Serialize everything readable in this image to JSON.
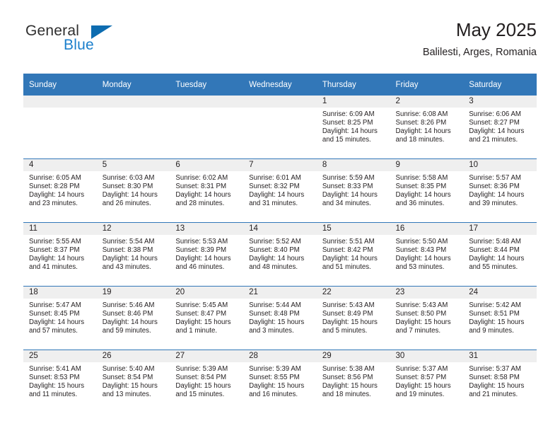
{
  "brand": {
    "name_part1": "General",
    "name_part2": "Blue",
    "icon": "triangle-logo-icon",
    "colors": {
      "blue": "#1b7fcc",
      "triangle": "#0d6cb0",
      "dark": "#2f2f2f"
    }
  },
  "header": {
    "title": "May 2025",
    "subtitle": "Balilesti, Arges, Romania"
  },
  "theme": {
    "header_row_bg": "#3277b8",
    "header_row_text": "#ffffff",
    "daynum_band_bg": "#efefef",
    "row_divider": "#3277b8",
    "cell_bg": "#ffffff",
    "text": "#231f20"
  },
  "weekdays": [
    "Sunday",
    "Monday",
    "Tuesday",
    "Wednesday",
    "Thursday",
    "Friday",
    "Saturday"
  ],
  "weeks": [
    [
      {
        "day": "",
        "lines": []
      },
      {
        "day": "",
        "lines": []
      },
      {
        "day": "",
        "lines": []
      },
      {
        "day": "",
        "lines": []
      },
      {
        "day": "1",
        "lines": [
          "Sunrise: 6:09 AM",
          "Sunset: 8:25 PM",
          "Daylight: 14 hours and 15 minutes."
        ]
      },
      {
        "day": "2",
        "lines": [
          "Sunrise: 6:08 AM",
          "Sunset: 8:26 PM",
          "Daylight: 14 hours and 18 minutes."
        ]
      },
      {
        "day": "3",
        "lines": [
          "Sunrise: 6:06 AM",
          "Sunset: 8:27 PM",
          "Daylight: 14 hours and 21 minutes."
        ]
      }
    ],
    [
      {
        "day": "4",
        "lines": [
          "Sunrise: 6:05 AM",
          "Sunset: 8:28 PM",
          "Daylight: 14 hours and 23 minutes."
        ]
      },
      {
        "day": "5",
        "lines": [
          "Sunrise: 6:03 AM",
          "Sunset: 8:30 PM",
          "Daylight: 14 hours and 26 minutes."
        ]
      },
      {
        "day": "6",
        "lines": [
          "Sunrise: 6:02 AM",
          "Sunset: 8:31 PM",
          "Daylight: 14 hours and 28 minutes."
        ]
      },
      {
        "day": "7",
        "lines": [
          "Sunrise: 6:01 AM",
          "Sunset: 8:32 PM",
          "Daylight: 14 hours and 31 minutes."
        ]
      },
      {
        "day": "8",
        "lines": [
          "Sunrise: 5:59 AM",
          "Sunset: 8:33 PM",
          "Daylight: 14 hours and 34 minutes."
        ]
      },
      {
        "day": "9",
        "lines": [
          "Sunrise: 5:58 AM",
          "Sunset: 8:35 PM",
          "Daylight: 14 hours and 36 minutes."
        ]
      },
      {
        "day": "10",
        "lines": [
          "Sunrise: 5:57 AM",
          "Sunset: 8:36 PM",
          "Daylight: 14 hours and 39 minutes."
        ]
      }
    ],
    [
      {
        "day": "11",
        "lines": [
          "Sunrise: 5:55 AM",
          "Sunset: 8:37 PM",
          "Daylight: 14 hours and 41 minutes."
        ]
      },
      {
        "day": "12",
        "lines": [
          "Sunrise: 5:54 AM",
          "Sunset: 8:38 PM",
          "Daylight: 14 hours and 43 minutes."
        ]
      },
      {
        "day": "13",
        "lines": [
          "Sunrise: 5:53 AM",
          "Sunset: 8:39 PM",
          "Daylight: 14 hours and 46 minutes."
        ]
      },
      {
        "day": "14",
        "lines": [
          "Sunrise: 5:52 AM",
          "Sunset: 8:40 PM",
          "Daylight: 14 hours and 48 minutes."
        ]
      },
      {
        "day": "15",
        "lines": [
          "Sunrise: 5:51 AM",
          "Sunset: 8:42 PM",
          "Daylight: 14 hours and 51 minutes."
        ]
      },
      {
        "day": "16",
        "lines": [
          "Sunrise: 5:50 AM",
          "Sunset: 8:43 PM",
          "Daylight: 14 hours and 53 minutes."
        ]
      },
      {
        "day": "17",
        "lines": [
          "Sunrise: 5:48 AM",
          "Sunset: 8:44 PM",
          "Daylight: 14 hours and 55 minutes."
        ]
      }
    ],
    [
      {
        "day": "18",
        "lines": [
          "Sunrise: 5:47 AM",
          "Sunset: 8:45 PM",
          "Daylight: 14 hours and 57 minutes."
        ]
      },
      {
        "day": "19",
        "lines": [
          "Sunrise: 5:46 AM",
          "Sunset: 8:46 PM",
          "Daylight: 14 hours and 59 minutes."
        ]
      },
      {
        "day": "20",
        "lines": [
          "Sunrise: 5:45 AM",
          "Sunset: 8:47 PM",
          "Daylight: 15 hours and 1 minute."
        ]
      },
      {
        "day": "21",
        "lines": [
          "Sunrise: 5:44 AM",
          "Sunset: 8:48 PM",
          "Daylight: 15 hours and 3 minutes."
        ]
      },
      {
        "day": "22",
        "lines": [
          "Sunrise: 5:43 AM",
          "Sunset: 8:49 PM",
          "Daylight: 15 hours and 5 minutes."
        ]
      },
      {
        "day": "23",
        "lines": [
          "Sunrise: 5:43 AM",
          "Sunset: 8:50 PM",
          "Daylight: 15 hours and 7 minutes."
        ]
      },
      {
        "day": "24",
        "lines": [
          "Sunrise: 5:42 AM",
          "Sunset: 8:51 PM",
          "Daylight: 15 hours and 9 minutes."
        ]
      }
    ],
    [
      {
        "day": "25",
        "lines": [
          "Sunrise: 5:41 AM",
          "Sunset: 8:53 PM",
          "Daylight: 15 hours and 11 minutes."
        ]
      },
      {
        "day": "26",
        "lines": [
          "Sunrise: 5:40 AM",
          "Sunset: 8:54 PM",
          "Daylight: 15 hours and 13 minutes."
        ]
      },
      {
        "day": "27",
        "lines": [
          "Sunrise: 5:39 AM",
          "Sunset: 8:54 PM",
          "Daylight: 15 hours and 15 minutes."
        ]
      },
      {
        "day": "28",
        "lines": [
          "Sunrise: 5:39 AM",
          "Sunset: 8:55 PM",
          "Daylight: 15 hours and 16 minutes."
        ]
      },
      {
        "day": "29",
        "lines": [
          "Sunrise: 5:38 AM",
          "Sunset: 8:56 PM",
          "Daylight: 15 hours and 18 minutes."
        ]
      },
      {
        "day": "30",
        "lines": [
          "Sunrise: 5:37 AM",
          "Sunset: 8:57 PM",
          "Daylight: 15 hours and 19 minutes."
        ]
      },
      {
        "day": "31",
        "lines": [
          "Sunrise: 5:37 AM",
          "Sunset: 8:58 PM",
          "Daylight: 15 hours and 21 minutes."
        ]
      }
    ]
  ]
}
